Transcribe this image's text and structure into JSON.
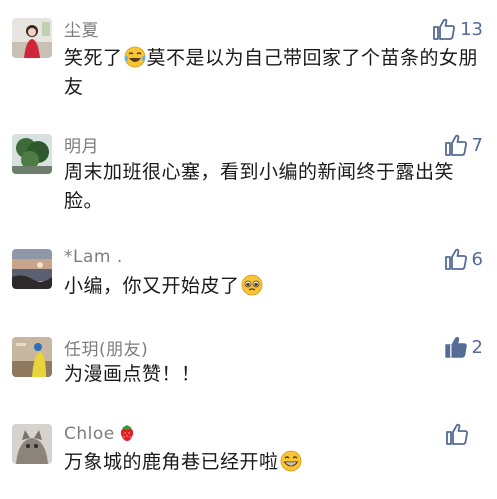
{
  "comments": [
    {
      "user": "尘夏",
      "likes": "13",
      "liked": false,
      "text_before": "笑死了",
      "emoji": "tears-of-joy-emoji",
      "text_after": "莫不是以为自己带回家了个苗条的女朋友"
    },
    {
      "user": "明月",
      "likes": "7",
      "liked": false,
      "text_before": "周末加班很心塞，看到小编的新闻终于露出笑脸。",
      "emoji": "",
      "text_after": ""
    },
    {
      "user": "*Lam .",
      "likes": "6",
      "liked": false,
      "text_before": "小编，你又开始皮了",
      "emoji": "pleading-face-emoji",
      "text_after": ""
    },
    {
      "user": "任玥(朋友)",
      "likes": "2",
      "liked": true,
      "text_before": "为漫画点赞！！",
      "emoji": "",
      "text_after": ""
    },
    {
      "user": "Chloe",
      "user_emoji": "strawberry-emoji",
      "likes": "",
      "liked": false,
      "text_before": "万象城的鹿角巷已经开啦",
      "emoji": "grinning-face-emoji",
      "text_after": ""
    }
  ],
  "colors": {
    "accent": "#566b95",
    "name": "#7d7d7d",
    "text": "#1a1a1a"
  }
}
